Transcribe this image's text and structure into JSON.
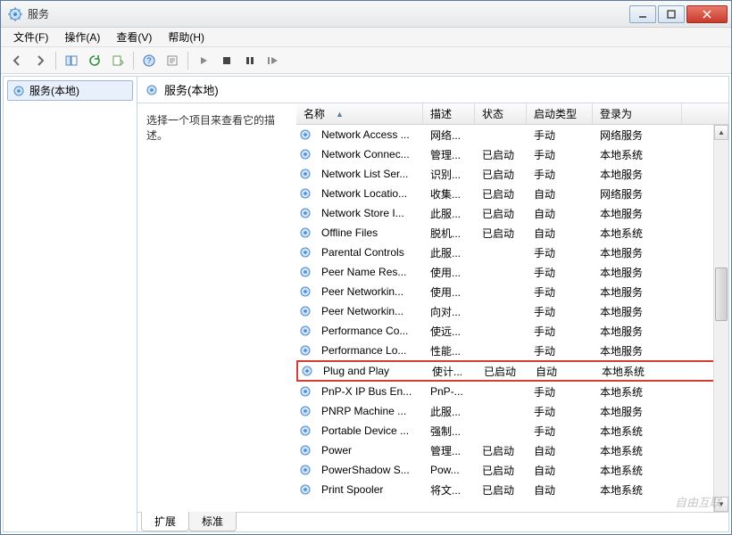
{
  "window": {
    "title": "服务"
  },
  "menubar": [
    {
      "label": "文件(F)"
    },
    {
      "label": "操作(A)"
    },
    {
      "label": "查看(V)"
    },
    {
      "label": "帮助(H)"
    }
  ],
  "left_pane": {
    "item_label": "服务(本地)"
  },
  "right_header": {
    "title": "服务(本地)"
  },
  "desc_pane": {
    "text": "选择一个项目来查看它的描述。"
  },
  "columns": {
    "name": "名称",
    "desc": "描述",
    "status": "状态",
    "start": "启动类型",
    "login": "登录为"
  },
  "rows": [
    {
      "name": "Network Access ...",
      "desc": "网络...",
      "status": "",
      "start": "手动",
      "login": "网络服务",
      "hl": false
    },
    {
      "name": "Network Connec...",
      "desc": "管理...",
      "status": "已启动",
      "start": "手动",
      "login": "本地系统",
      "hl": false
    },
    {
      "name": "Network List Ser...",
      "desc": "识别...",
      "status": "已启动",
      "start": "手动",
      "login": "本地服务",
      "hl": false
    },
    {
      "name": "Network Locatio...",
      "desc": "收集...",
      "status": "已启动",
      "start": "自动",
      "login": "网络服务",
      "hl": false
    },
    {
      "name": "Network Store I...",
      "desc": "此服...",
      "status": "已启动",
      "start": "自动",
      "login": "本地服务",
      "hl": false
    },
    {
      "name": "Offline Files",
      "desc": "脱机...",
      "status": "已启动",
      "start": "自动",
      "login": "本地系统",
      "hl": false
    },
    {
      "name": "Parental Controls",
      "desc": "此服...",
      "status": "",
      "start": "手动",
      "login": "本地服务",
      "hl": false
    },
    {
      "name": "Peer Name Res...",
      "desc": "使用...",
      "status": "",
      "start": "手动",
      "login": "本地服务",
      "hl": false
    },
    {
      "name": "Peer Networkin...",
      "desc": "使用...",
      "status": "",
      "start": "手动",
      "login": "本地服务",
      "hl": false
    },
    {
      "name": "Peer Networkin...",
      "desc": "向对...",
      "status": "",
      "start": "手动",
      "login": "本地服务",
      "hl": false
    },
    {
      "name": "Performance Co...",
      "desc": "使远...",
      "status": "",
      "start": "手动",
      "login": "本地服务",
      "hl": false
    },
    {
      "name": "Performance Lo...",
      "desc": "性能...",
      "status": "",
      "start": "手动",
      "login": "本地服务",
      "hl": false
    },
    {
      "name": "Plug and Play",
      "desc": "使计...",
      "status": "已启动",
      "start": "自动",
      "login": "本地系统",
      "hl": true
    },
    {
      "name": "PnP-X IP Bus En...",
      "desc": "PnP-...",
      "status": "",
      "start": "手动",
      "login": "本地系统",
      "hl": false
    },
    {
      "name": "PNRP Machine ...",
      "desc": "此服...",
      "status": "",
      "start": "手动",
      "login": "本地服务",
      "hl": false
    },
    {
      "name": "Portable Device ...",
      "desc": "强制...",
      "status": "",
      "start": "手动",
      "login": "本地系统",
      "hl": false
    },
    {
      "name": "Power",
      "desc": "管理...",
      "status": "已启动",
      "start": "自动",
      "login": "本地系统",
      "hl": false
    },
    {
      "name": "PowerShadow S...",
      "desc": "Pow...",
      "status": "已启动",
      "start": "自动",
      "login": "本地系统",
      "hl": false
    },
    {
      "name": "Print Spooler",
      "desc": "将文...",
      "status": "已启动",
      "start": "自动",
      "login": "本地系统",
      "hl": false
    }
  ],
  "tabs": {
    "ext": "扩展",
    "std": "标准"
  },
  "watermark": "自由互联"
}
